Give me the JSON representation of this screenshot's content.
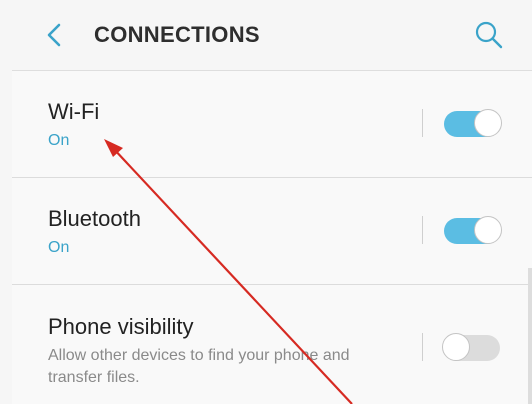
{
  "header": {
    "title": "CONNECTIONS",
    "back_icon": "chevron-left-icon",
    "search_icon": "search-icon"
  },
  "settings": [
    {
      "title": "Wi-Fi",
      "subtitle": "On",
      "state": "on"
    },
    {
      "title": "Bluetooth",
      "subtitle": "On",
      "state": "on"
    },
    {
      "title": "Phone visibility",
      "description": "Allow other devices to find your phone and transfer files.",
      "state": "off"
    }
  ],
  "colors": {
    "accent": "#3aa3c9",
    "toggle_on": "#5bbde3",
    "toggle_off": "#dcdcdc",
    "annotation_arrow": "#d62a22"
  },
  "annotation": {
    "type": "arrow",
    "points_to": "Wi-Fi setting"
  }
}
